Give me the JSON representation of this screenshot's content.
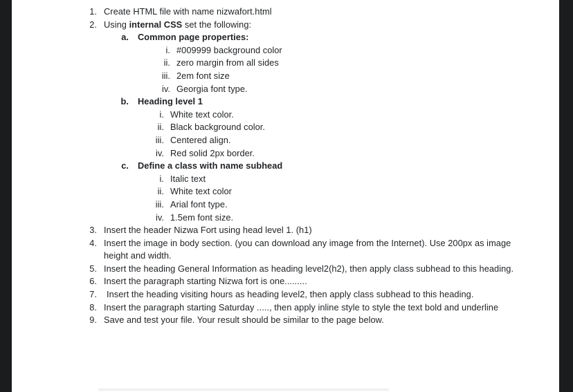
{
  "document": {
    "title": "HTML/CSS assignment instruction sheet",
    "text_color": "#1f2124",
    "page_background": "#ffffff",
    "scan_edge_color": "#1b1c1e"
  },
  "items": [
    {
      "level": 1,
      "marker": "1.",
      "text": "Create HTML file with name nizwafort.html"
    },
    {
      "level": 1,
      "marker": "2.",
      "text_pre": "Using ",
      "text_bold": "internal CSS",
      "text_post": " set the following:"
    },
    {
      "level": 2,
      "marker": "a.",
      "text": "Common page properties:"
    },
    {
      "level": 3,
      "group": "a",
      "marker": "i.",
      "text": "#009999 background color"
    },
    {
      "level": 3,
      "group": "a",
      "marker": "ii.",
      "text": "zero margin from all sides"
    },
    {
      "level": 3,
      "group": "a",
      "marker": "iii.",
      "text": "2em font size"
    },
    {
      "level": 3,
      "group": "a",
      "marker": "iv.",
      "text": "Georgia font type."
    },
    {
      "level": 2,
      "marker": "b.",
      "text": "Heading level 1"
    },
    {
      "level": 3,
      "group": "b",
      "marker": "i.",
      "text": "White text color."
    },
    {
      "level": 3,
      "group": "b",
      "marker": "ii.",
      "text": "Black background color."
    },
    {
      "level": 3,
      "group": "b",
      "marker": "iii.",
      "text": "Centered align."
    },
    {
      "level": 3,
      "group": "b",
      "marker": "iv.",
      "text": "Red solid 2px border."
    },
    {
      "level": 2,
      "marker": "c.",
      "text": "Define a class with name subhead"
    },
    {
      "level": 3,
      "group": "c",
      "marker": "i.",
      "text": "Italic text"
    },
    {
      "level": 3,
      "group": "c",
      "marker": "ii.",
      "text": "White text color"
    },
    {
      "level": 3,
      "group": "c",
      "marker": "iii.",
      "text": "Arial font type."
    },
    {
      "level": 3,
      "group": "c",
      "marker": "iv.",
      "text": "1.5em font size."
    },
    {
      "level": 1,
      "marker": "3.",
      "text": "Insert the header Nizwa Fort using head level 1. (h1)"
    },
    {
      "level": 1,
      "marker": "4.",
      "text": "Insert the image in body section. (you can download any image from the Internet). Use 200px as image height and width."
    },
    {
      "level": 1,
      "marker": "5.",
      "text": "Insert the heading General Information as heading level2(h2), then apply class subhead to this heading."
    },
    {
      "level": 1,
      "marker": "6.",
      "text": "Insert the paragraph starting Nizwa fort is one........."
    },
    {
      "level": 1,
      "marker": "7.",
      "text": "Insert the heading visiting hours as heading level2, then apply class subhead to this heading."
    },
    {
      "level": 1,
      "marker": "8.",
      "text": "Insert the paragraph starting  Saturday ....., then apply inline style to style the text bold and underline"
    },
    {
      "level": 1,
      "marker": "9.",
      "text": "Save and test your file. Your result should be similar to the page below."
    }
  ],
  "labels": {
    "item_1_marker": "1.",
    "item_2_marker": "2.",
    "item_2_pre": "Using ",
    "item_2_bold": "internal CSS",
    "item_2_post": " set the following:"
  }
}
